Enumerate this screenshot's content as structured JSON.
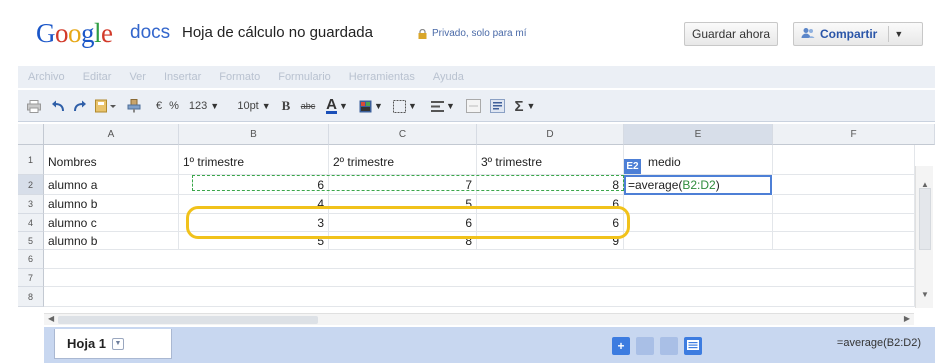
{
  "header": {
    "logo_text": "Google",
    "product": "docs",
    "doc_title": "Hoja de cálculo no guardada",
    "privacy": "Privado, solo para mí",
    "save_label": "Guardar ahora",
    "share_label": "Compartir"
  },
  "menu": [
    "Archivo",
    "Editar",
    "Ver",
    "Insertar",
    "Formato",
    "Formulario",
    "Herramientas",
    "Ayuda"
  ],
  "toolbar": {
    "currency": "€",
    "percent": "%",
    "number_format": "123",
    "font_size": "10pt",
    "bold": "B",
    "strike": "abc",
    "text_color": "A",
    "sum": "Σ"
  },
  "grid": {
    "columns": [
      "A",
      "B",
      "C",
      "D",
      "E",
      "F"
    ],
    "rows": [
      "1",
      "2",
      "3",
      "4",
      "5",
      "6",
      "7",
      "8"
    ],
    "cells": {
      "A1": "Nombres",
      "B1": "1º trimestre",
      "C1": "2º trimestre",
      "D1": "3º trimestre",
      "E1": "medio",
      "A2": "alumno a",
      "B2": "6",
      "C2": "7",
      "D2": "8",
      "A3": "alumno b",
      "B3": "4",
      "C3": "5",
      "D3": "6",
      "A4": "alumno c",
      "B4": "3",
      "C4": "6",
      "D4": "6",
      "A5": "alumno b",
      "B5": "5",
      "C5": "8",
      "D5": "9"
    },
    "active_cell": {
      "tag": "E2",
      "formula_prefix": "=average(",
      "formula_ref": "B2:D2",
      "formula_suffix": ")"
    }
  },
  "bottom": {
    "sheet_name": "Hoja 1",
    "formula_display": "=average(B2:D2)"
  },
  "colors": {
    "accent_blue": "#4d7fd6",
    "highlight_yellow": "#f1c21b",
    "formula_ref_green": "#2f8c3c",
    "bottom_bar": "#c8d7f0"
  }
}
